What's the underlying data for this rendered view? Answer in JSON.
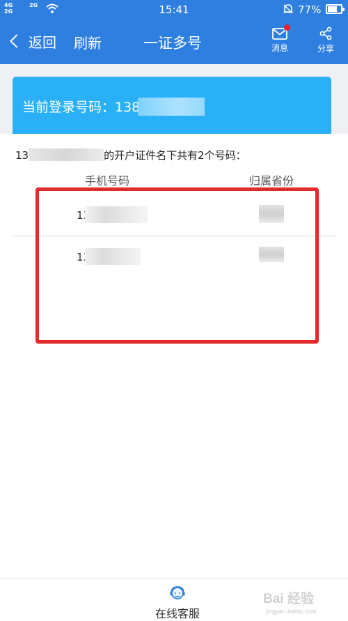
{
  "status_bar": {
    "network_1": "4G",
    "network_1b": "2G",
    "network_2": "2G",
    "time": "15:41",
    "battery": "77%",
    "battery_level": 0.77
  },
  "navbar": {
    "back_label": "返回",
    "refresh_label": "刷新",
    "title": "一证多号",
    "messages_label": "消息",
    "share_label": "分享"
  },
  "login_card": {
    "text": "当前登录号码：138"
  },
  "owner_info": {
    "prefix": "13",
    "suffix": "的开户证件名下共有2个号码："
  },
  "table": {
    "headers": [
      "手机号码",
      "归属省份"
    ],
    "rows": [
      {
        "phone": "13 ****"
      },
      {
        "phone": "13 ****"
      }
    ]
  },
  "bottom_bar": {
    "customer_service_label": "在线客服"
  },
  "watermark": {
    "brand": "Bai 经验",
    "url": "jingyan.baidu.com"
  },
  "colors": {
    "header_blue": "#2f7fe0",
    "card_blue": "#29b0f7",
    "highlight_red": "#e52a2a",
    "badge_red": "#e8202a"
  }
}
